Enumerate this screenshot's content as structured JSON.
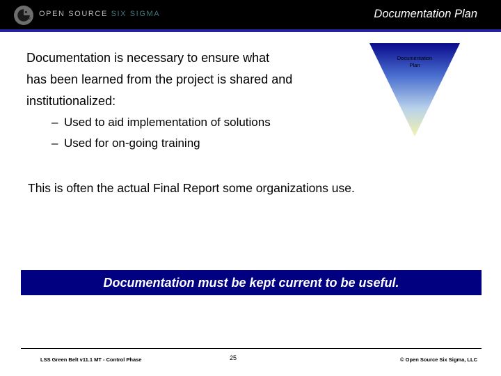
{
  "header": {
    "brand_part1": "OPEN SOURCE ",
    "brand_part2": "SIX SIGMA",
    "title": "Documentation Plan",
    "logo_icon": "open-source-six-sigma-logo",
    "rule_color": "#23239c",
    "background_color": "#000000"
  },
  "body": {
    "lines": [
      "Documentation is necessary to ensure what",
      "has been learned from the project is shared and",
      "institutionalized:"
    ],
    "bullets": [
      "Used to aid implementation of solutions",
      "Used for on-going training"
    ],
    "bullet_marker": "–",
    "paragraph2": "This is often the actual Final Report some organizations use."
  },
  "graphic": {
    "name": "funnel-triangle",
    "label_line1": "Documentation",
    "label_line2": "Plan",
    "gradient_top": "#0a0a8c",
    "gradient_bottom": "#f2f2b0"
  },
  "callout": {
    "text": "Documentation must be kept current to be useful.",
    "background_color": "#000080",
    "text_color": "#ffffff"
  },
  "footer": {
    "left": "LSS Green Belt v11.1 MT - Control Phase",
    "page_number": "25",
    "right": "© Open Source Six Sigma, LLC"
  }
}
